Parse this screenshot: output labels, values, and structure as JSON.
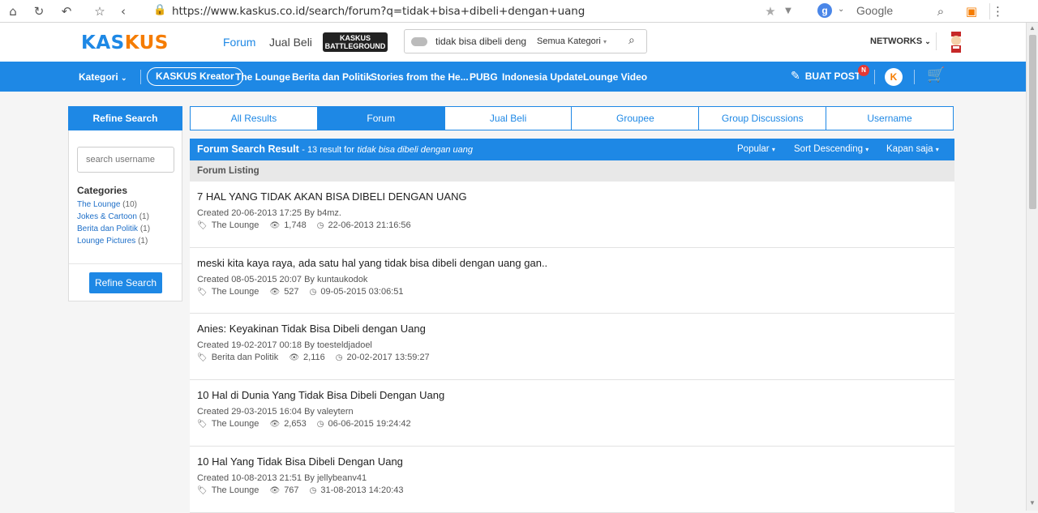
{
  "browser": {
    "url": "https://www.kaskus.co.id/search/forum?q=tidak+bisa+dibeli+dengan+uang",
    "search_engine": "Google",
    "icons": [
      "home-icon",
      "reload-icon",
      "undo-icon",
      "star-icon",
      "back-icon"
    ]
  },
  "site": {
    "logo_left": "KAS",
    "logo_right": "KUS",
    "nav_forum": "Forum",
    "nav_jualbeli": "Jual Beli",
    "battleground_top": "KASKUS",
    "battleground_bottom": "BATTLEGROUND",
    "search_value": "tidak bisa dibeli deng",
    "search_category": "Semua Kategori",
    "networks": "NETWORKS"
  },
  "bluebar": {
    "kategori": "Kategori",
    "items": [
      "KASKUS Kreator",
      "The Lounge",
      "Berita dan Politik",
      "Stories from the He...",
      "PUBG",
      "Indonesia Update",
      "Lounge Video"
    ],
    "buat_post": "BUAT POST",
    "badge": "N"
  },
  "sidebar": {
    "refine_title": "Refine Search",
    "username_placeholder": "search username",
    "categories_title": "Categories",
    "categories": [
      {
        "label": "The Lounge",
        "count": "(10)"
      },
      {
        "label": "Jokes & Cartoon",
        "count": "(1)"
      },
      {
        "label": "Berita dan Politik",
        "count": "(1)"
      },
      {
        "label": "Lounge Pictures",
        "count": "(1)"
      }
    ],
    "refine_button": "Refine Search"
  },
  "tabs": [
    "All Results",
    "Forum",
    "Jual Beli",
    "Groupee",
    "Group Discussions",
    "Username"
  ],
  "active_tab": "Forum",
  "result_header": {
    "title": "Forum Search Result",
    "count_text": "- 13 result for",
    "query": "tidak bisa dibeli dengan uang",
    "sort_popular": "Popular",
    "sort_order": "Sort Descending",
    "sort_time": "Kapan saja"
  },
  "listing_label": "Forum Listing",
  "results": [
    {
      "title": "7 HAL YANG TIDAK AKAN BISA DIBELI DENGAN UANG",
      "created": "Created 20-06-2013 17:25 By b4mz.",
      "category": "The Lounge",
      "views": "1,748",
      "last": "22-06-2013 21:16:56"
    },
    {
      "title": "meski kita kaya raya, ada satu hal yang tidak bisa dibeli dengan uang gan..",
      "created": "Created 08-05-2015 20:07 By kuntaukodok",
      "category": "The Lounge",
      "views": "527",
      "last": "09-05-2015 03:06:51"
    },
    {
      "title": "Anies: Keyakinan Tidak Bisa Dibeli dengan Uang",
      "created": "Created 19-02-2017 00:18 By toesteldjadoel",
      "category": "Berita dan Politik",
      "views": "2,116",
      "last": "20-02-2017 13:59:27"
    },
    {
      "title": "10 Hal di Dunia Yang Tidak Bisa Dibeli Dengan Uang",
      "created": "Created 29-03-2015 16:04 By valeytern",
      "category": "The Lounge",
      "views": "2,653",
      "last": "06-06-2015 19:24:42"
    },
    {
      "title": "10 Hal Yang Tidak Bisa Dibeli Dengan Uang",
      "created": "Created 10-08-2013 21:51 By jellybeanv41",
      "category": "The Lounge",
      "views": "767",
      "last": "31-08-2013 14:20:43"
    }
  ],
  "colors": {
    "primary": "#1e88e5",
    "logo_orange": "#f57c00",
    "badge": "#e53935"
  }
}
